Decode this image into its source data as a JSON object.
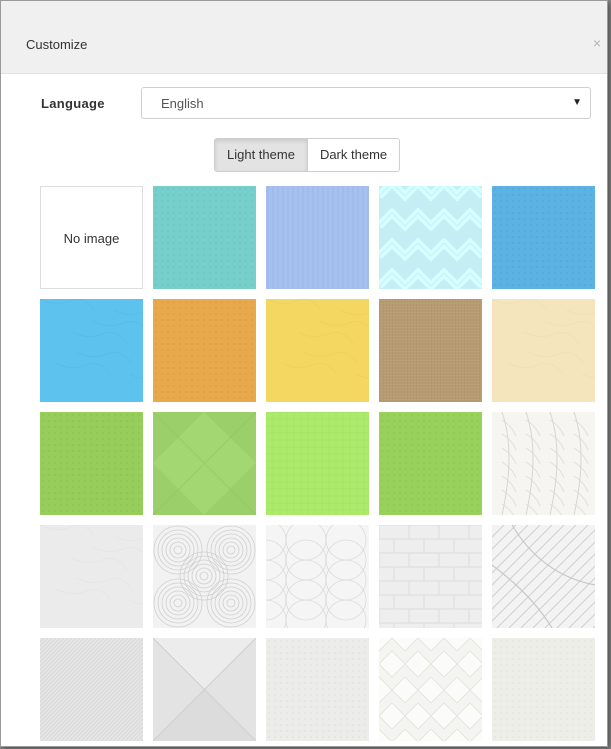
{
  "dialog": {
    "title": "Customize",
    "close_glyph": "×",
    "close_icon": "close-icon"
  },
  "language": {
    "label": "Language",
    "selected": "English",
    "arrow_glyph": "▼"
  },
  "themes": {
    "light_label": "Light theme",
    "dark_label": "Dark theme",
    "active": "light"
  },
  "backgrounds": {
    "no_image_label": "No image",
    "tiles": [
      {
        "name": "no-image",
        "color": "#ffffff",
        "pattern": "none"
      },
      {
        "name": "teal-fabric",
        "color": "#76cfcb",
        "pattern": "dots"
      },
      {
        "name": "blue-stripes",
        "color": "#a6c0ef",
        "pattern": "vstripes"
      },
      {
        "name": "light-cyan-chevron",
        "color": "#c4eef3",
        "pattern": "chevron"
      },
      {
        "name": "sky-blue-fabric",
        "color": "#5cb2e2",
        "pattern": "dots"
      },
      {
        "name": "bright-blue-plaster",
        "color": "#5ec2ef",
        "pattern": "plaster"
      },
      {
        "name": "orange-canvas",
        "color": "#e7a94c",
        "pattern": "dots"
      },
      {
        "name": "yellow-plaster",
        "color": "#f3d760",
        "pattern": "plaster"
      },
      {
        "name": "burlap",
        "color": "#b79b72",
        "pattern": "weave"
      },
      {
        "name": "cream-paper",
        "color": "#f4e5bd",
        "pattern": "plaster"
      },
      {
        "name": "green-dots",
        "color": "#96cd5b",
        "pattern": "dots"
      },
      {
        "name": "green-diamonds",
        "color": "#9acf6a",
        "pattern": "diamonds"
      },
      {
        "name": "lime-grid",
        "color": "#acea6c",
        "pattern": "grid"
      },
      {
        "name": "green-plain",
        "color": "#98d15c",
        "pattern": "dots"
      },
      {
        "name": "white-leaves",
        "color": "#f7f5f2",
        "pattern": "leaves"
      },
      {
        "name": "grey-marble",
        "color": "#ebebeb",
        "pattern": "plaster"
      },
      {
        "name": "white-circles",
        "color": "#f2f2f2",
        "pattern": "circles"
      },
      {
        "name": "white-scales",
        "color": "#f5f5f5",
        "pattern": "scales"
      },
      {
        "name": "white-bricks",
        "color": "#eeeeee",
        "pattern": "bricks"
      },
      {
        "name": "white-geometric",
        "color": "#f3f3f3",
        "pattern": "lines"
      },
      {
        "name": "grey-diagonal",
        "color": "#e6e6e6",
        "pattern": "diagonal"
      },
      {
        "name": "grey-pyramid",
        "color": "#e3e3e3",
        "pattern": "pyramid"
      },
      {
        "name": "light-beige-dots",
        "color": "#ececea",
        "pattern": "dots"
      },
      {
        "name": "white-argyle",
        "color": "#f4f4f1",
        "pattern": "argyle"
      },
      {
        "name": "beige-texture",
        "color": "#eeeee8",
        "pattern": "dots"
      }
    ]
  }
}
